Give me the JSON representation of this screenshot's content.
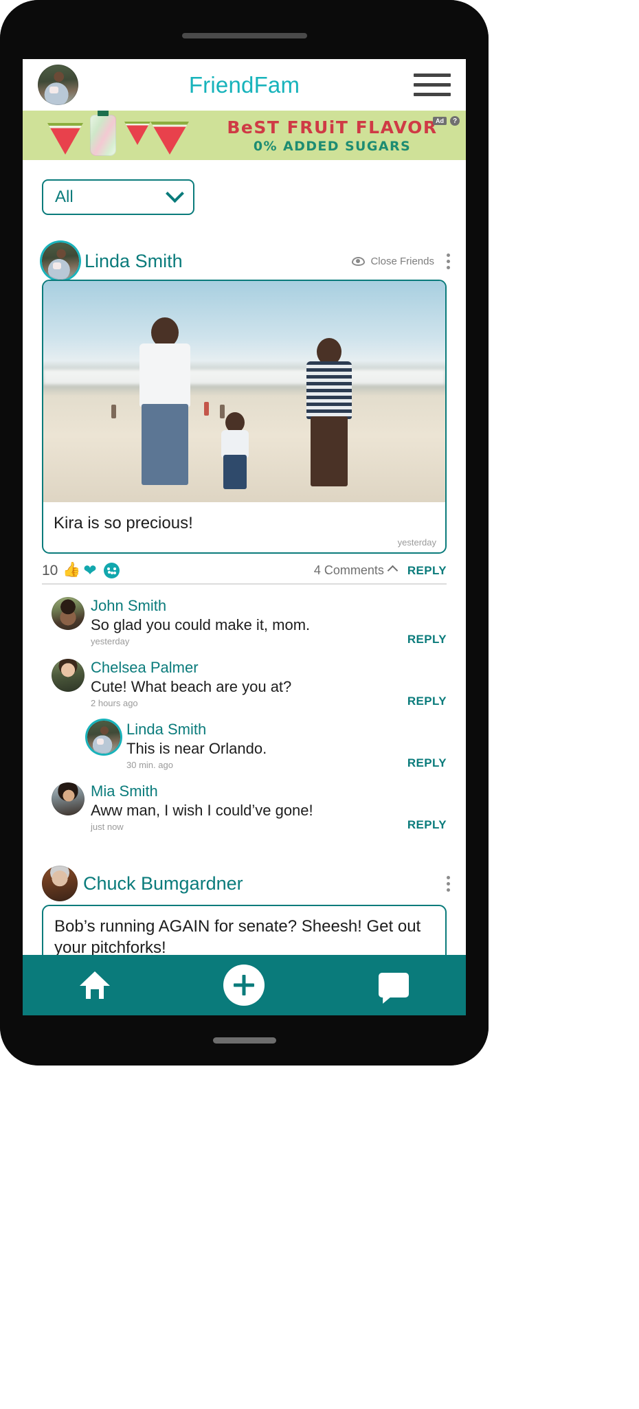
{
  "app": {
    "brand": "FriendFam",
    "header_avatar_name": "Linda Smith",
    "menu_icon": "hamburger-menu-icon"
  },
  "ad": {
    "line1": "BeST FRUiT FLAVOR",
    "line2": "0% ADDED SUGARS",
    "badge": "Ad",
    "help_badge": "?",
    "bg_color": "#cfe198",
    "line1_color": "#cf3a45",
    "line2_color": "#1d8c72"
  },
  "filter": {
    "selected": "All",
    "options": [
      "All"
    ]
  },
  "posts": [
    {
      "author": "Linda Smith",
      "audience": "Close Friends",
      "audience_icon": "eye-icon",
      "menu_icon": "kebab-menu-icon",
      "caption": "Kira is so precious!",
      "timestamp": "yesterday",
      "reaction_count": "10",
      "reactions": [
        "thumbs-up-icon",
        "heart-icon",
        "smiley-icon"
      ],
      "comments_label": "4 Comments",
      "reply_label": "REPLY",
      "comments": [
        {
          "author": "John Smith",
          "text": "So glad you could make it, mom.",
          "timestamp": "yesterday",
          "reply_label": "REPLY",
          "indent": false
        },
        {
          "author": "Chelsea Palmer",
          "text": "Cute! What beach are you at?",
          "timestamp": "2 hours ago",
          "reply_label": "REPLY",
          "indent": false
        },
        {
          "author": "Linda Smith",
          "text": "This is near Orlando.",
          "timestamp": "30 min. ago",
          "reply_label": "REPLY",
          "indent": true
        },
        {
          "author": "Mia Smith",
          "text": "Aww man, I wish I could’ve gone!",
          "timestamp": "just now",
          "reply_label": "REPLY",
          "indent": false
        }
      ]
    },
    {
      "author": "Chuck Bumgardner",
      "menu_icon": "kebab-menu-icon",
      "text": "Bob’s running AGAIN for senate? Sheesh! Get out your pitchforks!"
    }
  ],
  "bottom_nav": {
    "home_icon": "home-icon",
    "create_icon": "plus-icon",
    "messages_icon": "chat-bubble-icon",
    "bg_color": "#0a7b7b"
  },
  "theme": {
    "accent": "#0a7b7b",
    "brand_teal": "#17b3bb",
    "reaction_teal": "#12a7ad"
  }
}
